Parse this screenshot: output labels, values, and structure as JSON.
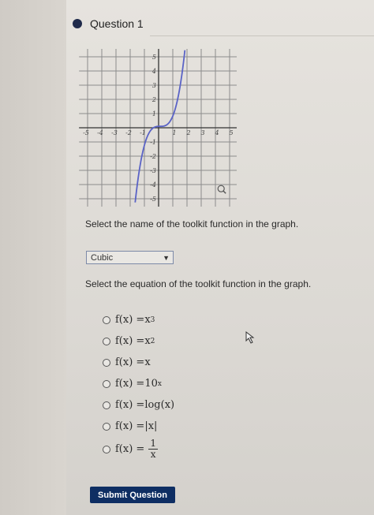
{
  "question": {
    "title": "Question 1"
  },
  "graph": {
    "x_ticks": [
      "-5",
      "-4",
      "-3",
      "-2",
      "-1",
      "1",
      "2",
      "3",
      "4",
      "5"
    ],
    "y_ticks": [
      "5",
      "4",
      "3",
      "2",
      "1",
      "-1",
      "-2",
      "-3",
      "-4",
      "-5"
    ],
    "curve": "f(x) = x^3",
    "icon": "zoom-icon",
    "curve_color": "#5a63c6"
  },
  "prompts": {
    "name": "Select the name of the toolkit function in the graph.",
    "equation": "Select the equation of the toolkit function in the graph."
  },
  "name_select": {
    "value": "Cubic"
  },
  "equation_options": [
    {
      "prefix": "f(x) = ",
      "expr": "x",
      "sup": "3"
    },
    {
      "prefix": "f(x) = ",
      "expr": "x",
      "sup": "2"
    },
    {
      "prefix": "f(x) = ",
      "expr": "x",
      "sup": ""
    },
    {
      "prefix": "f(x) = ",
      "expr": "10",
      "sup": "x"
    },
    {
      "prefix": "f(x) = ",
      "expr": "log(x)",
      "sup": ""
    },
    {
      "prefix": "f(x) = ",
      "expr": "|x|",
      "sup": ""
    },
    {
      "prefix": "f(x) = ",
      "num": "1",
      "den": "x"
    }
  ],
  "submit": {
    "label": "Submit Question",
    "color": "#0e2e63"
  }
}
